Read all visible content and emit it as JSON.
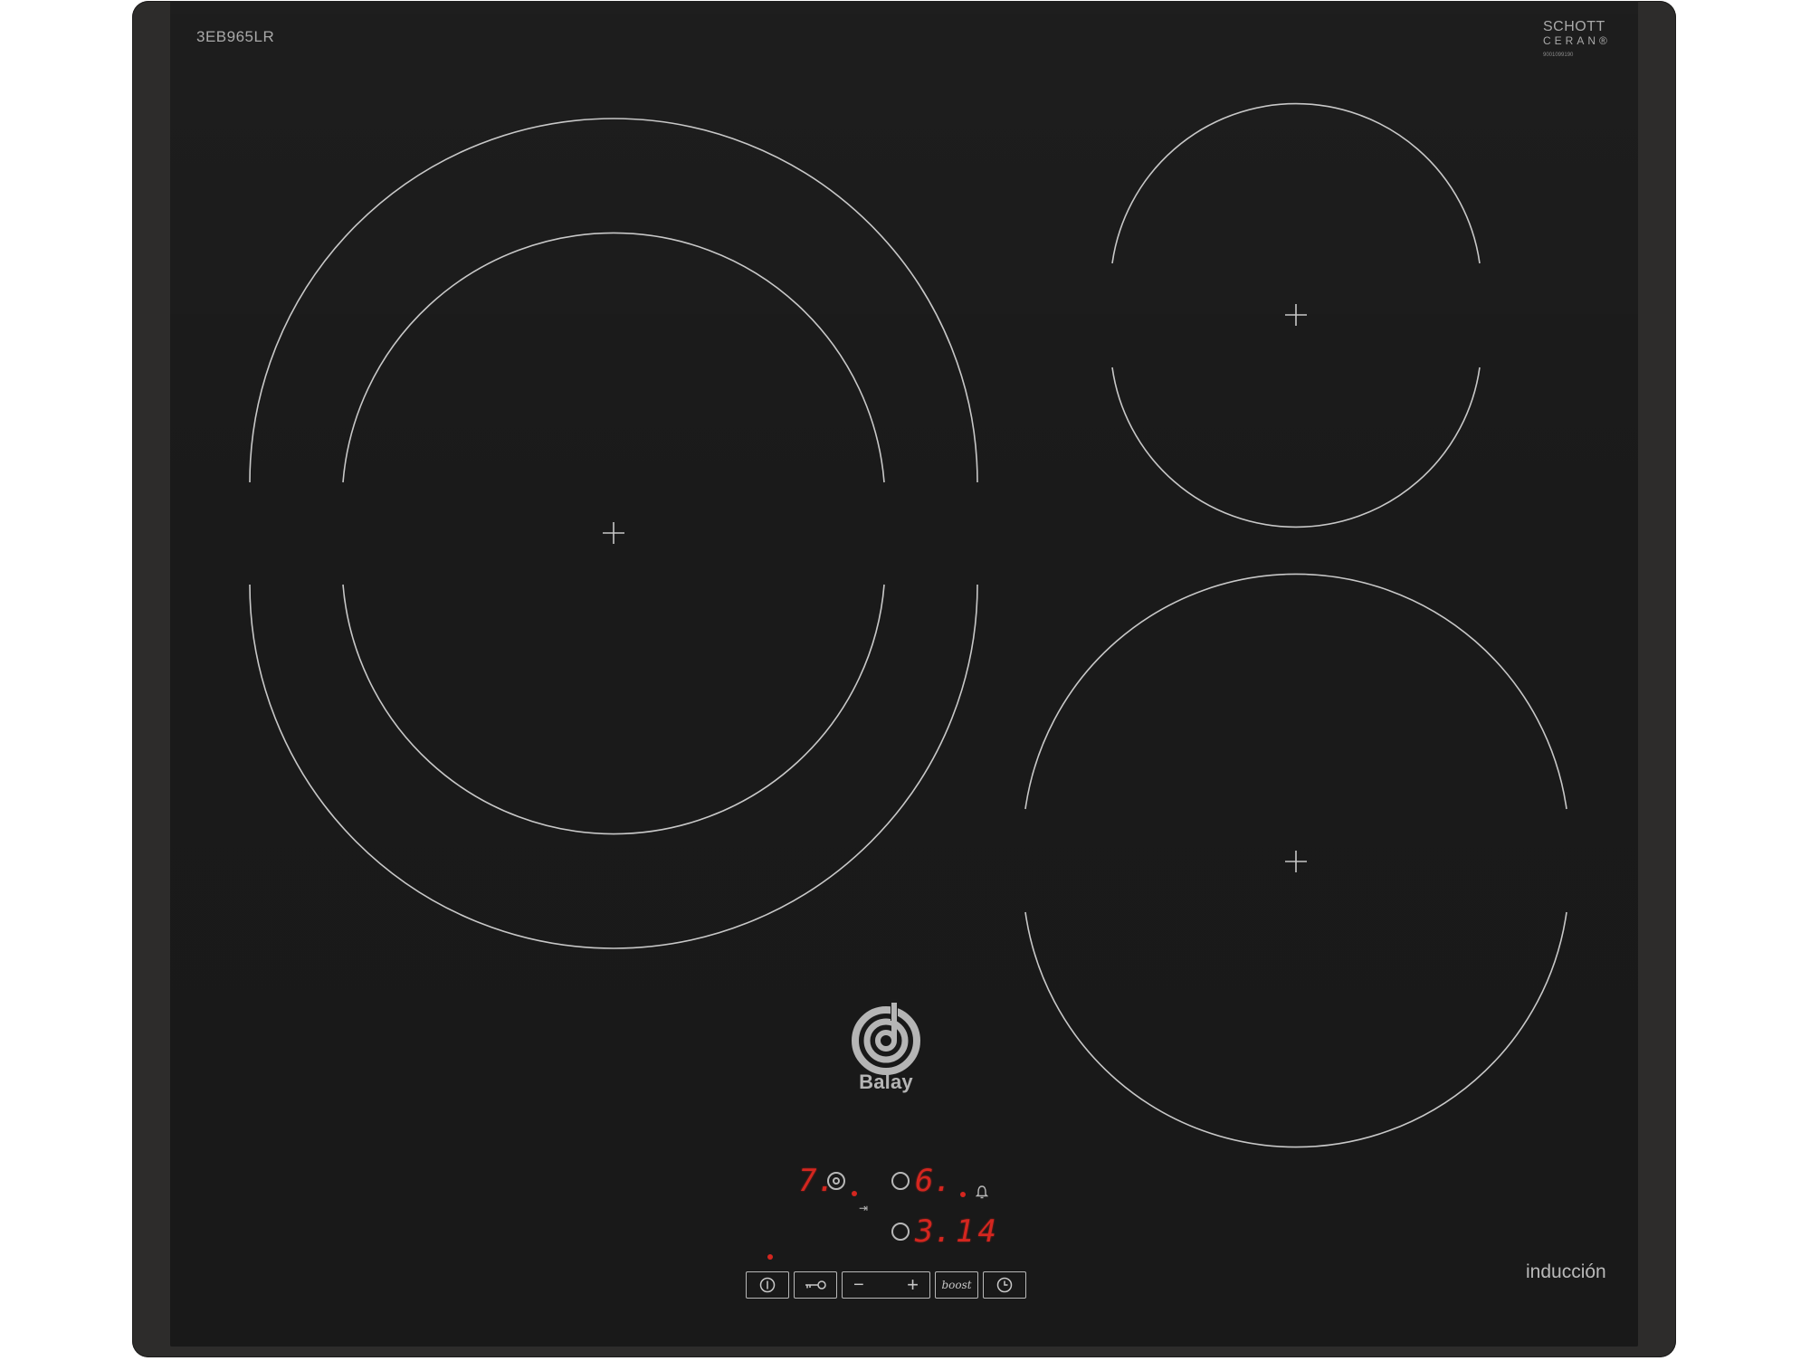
{
  "cooktop": {
    "model_label": "3EB965LR",
    "glass_brand_line1": "SCHOTT",
    "glass_brand_line2": "CERAN®",
    "glass_serial": "9001099190",
    "technology_label": "inducción",
    "brand_name": "Balay",
    "colors": {
      "frame": "#2d2c2b",
      "glass": "#1a1a1a",
      "zone_lines": "#c8c8c8",
      "display_red": "#d4261f"
    }
  },
  "cooking_zones": [
    {
      "name": "front-left dual zone",
      "type": "dual-ring"
    },
    {
      "name": "rear-right small zone",
      "type": "single"
    },
    {
      "name": "front-right zone",
      "type": "single"
    }
  ],
  "control_panel": {
    "zone_displays": [
      {
        "label": "7.",
        "icon": "double-zone-icon"
      },
      {
        "label": "6.",
        "icon": "zone-icon"
      },
      {
        "label": "3.",
        "icon": "zone-icon"
      }
    ],
    "timer_display": "14",
    "indicator_icons": [
      "transfer-icon",
      "bell-icon"
    ],
    "buttons": [
      {
        "name": "power",
        "icon": "power-icon"
      },
      {
        "name": "child-lock",
        "icon": "key-icon"
      },
      {
        "name": "minus",
        "label": "−"
      },
      {
        "name": "plus",
        "label": "+"
      },
      {
        "name": "boost",
        "label": "boost"
      },
      {
        "name": "timer",
        "icon": "clock-icon"
      }
    ]
  }
}
